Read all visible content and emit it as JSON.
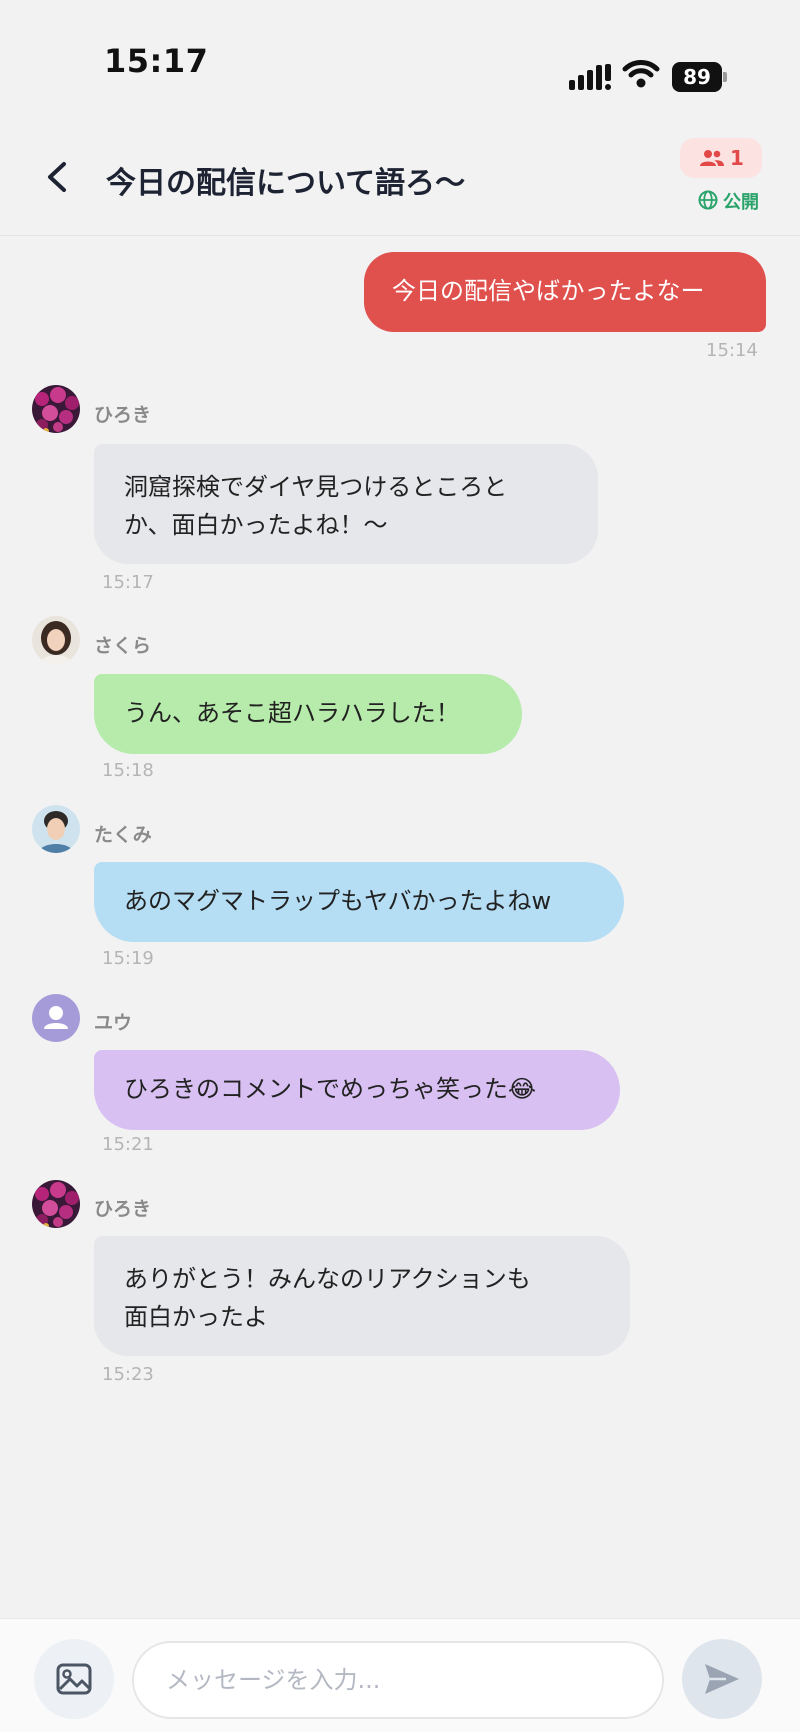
{
  "status_bar": {
    "time": "15:17",
    "battery": "89"
  },
  "header": {
    "title": "今日の配信について語ろ～",
    "member_count": "1",
    "visibility": "公開"
  },
  "messages": [
    {
      "sender": "",
      "text_lines": [
        "今日の配信やばかったよなー"
      ],
      "time": "15:14",
      "outgoing": true
    },
    {
      "sender": "ひろき",
      "text_lines": [
        "洞窟探検でダイヤ見つけるところと",
        "か、面白かったよね！～"
      ],
      "time": "15:17",
      "color": "#e6e7ea"
    },
    {
      "sender": "さくら",
      "text_lines": [
        "うん、あそこ超ハラハラした！"
      ],
      "time": "15:18",
      "color": "#b7ebab"
    },
    {
      "sender": "たくみ",
      "text_lines": [
        "あのマグマトラップもヤバかったよねw"
      ],
      "time": "15:19",
      "color": "#b5def5"
    },
    {
      "sender": "ユウ",
      "text_lines": [
        "ひろきのコメントでめっちゃ笑った😂"
      ],
      "time": "15:21",
      "color": "#d8c0f2"
    },
    {
      "sender": "ひろき",
      "text_lines": [
        "ありがとう！みんなのリアクションも",
        "面白かったよ"
      ],
      "time": "15:23",
      "color": "#e6e7ea"
    }
  ],
  "input": {
    "placeholder": "メッセージを入力..."
  },
  "colors": {
    "outgoing": "#e0504c",
    "public": "#2aa36b",
    "badge_text": "#e34848",
    "badge_bg": "#fde2e2"
  }
}
